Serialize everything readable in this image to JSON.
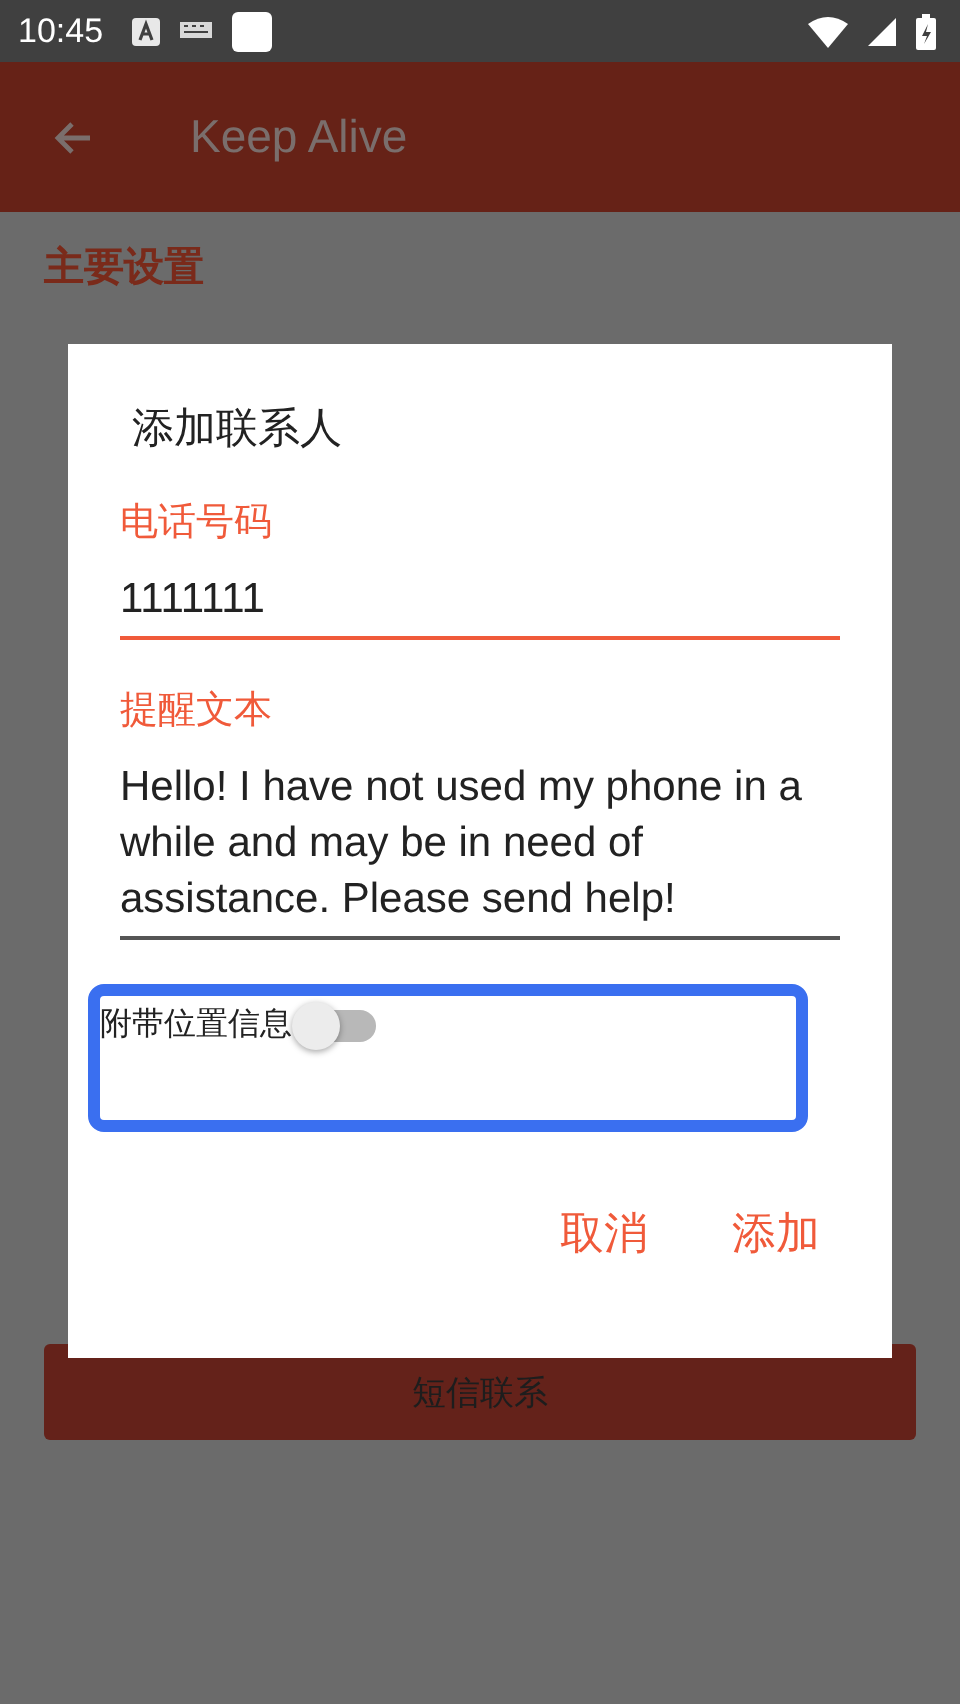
{
  "status_bar": {
    "time": "10:45"
  },
  "app_bar": {
    "title": "Keep Alive"
  },
  "section_header": "主要设置",
  "dialog": {
    "title": "添加联系人",
    "fields": [
      {
        "label": "电话号码",
        "value": "1111111",
        "focused": true
      },
      {
        "label": "提醒文本",
        "value": "Hello! I have not used my phone in a while and may be in need of assistance. Please send help!",
        "focused": false
      }
    ],
    "toggle": {
      "label": "附带位置信息",
      "on": false,
      "highlighted": true
    },
    "buttons": [
      {
        "label": "取消"
      },
      {
        "label": "添加"
      }
    ]
  },
  "bottom_button": {
    "label": "短信联系"
  }
}
